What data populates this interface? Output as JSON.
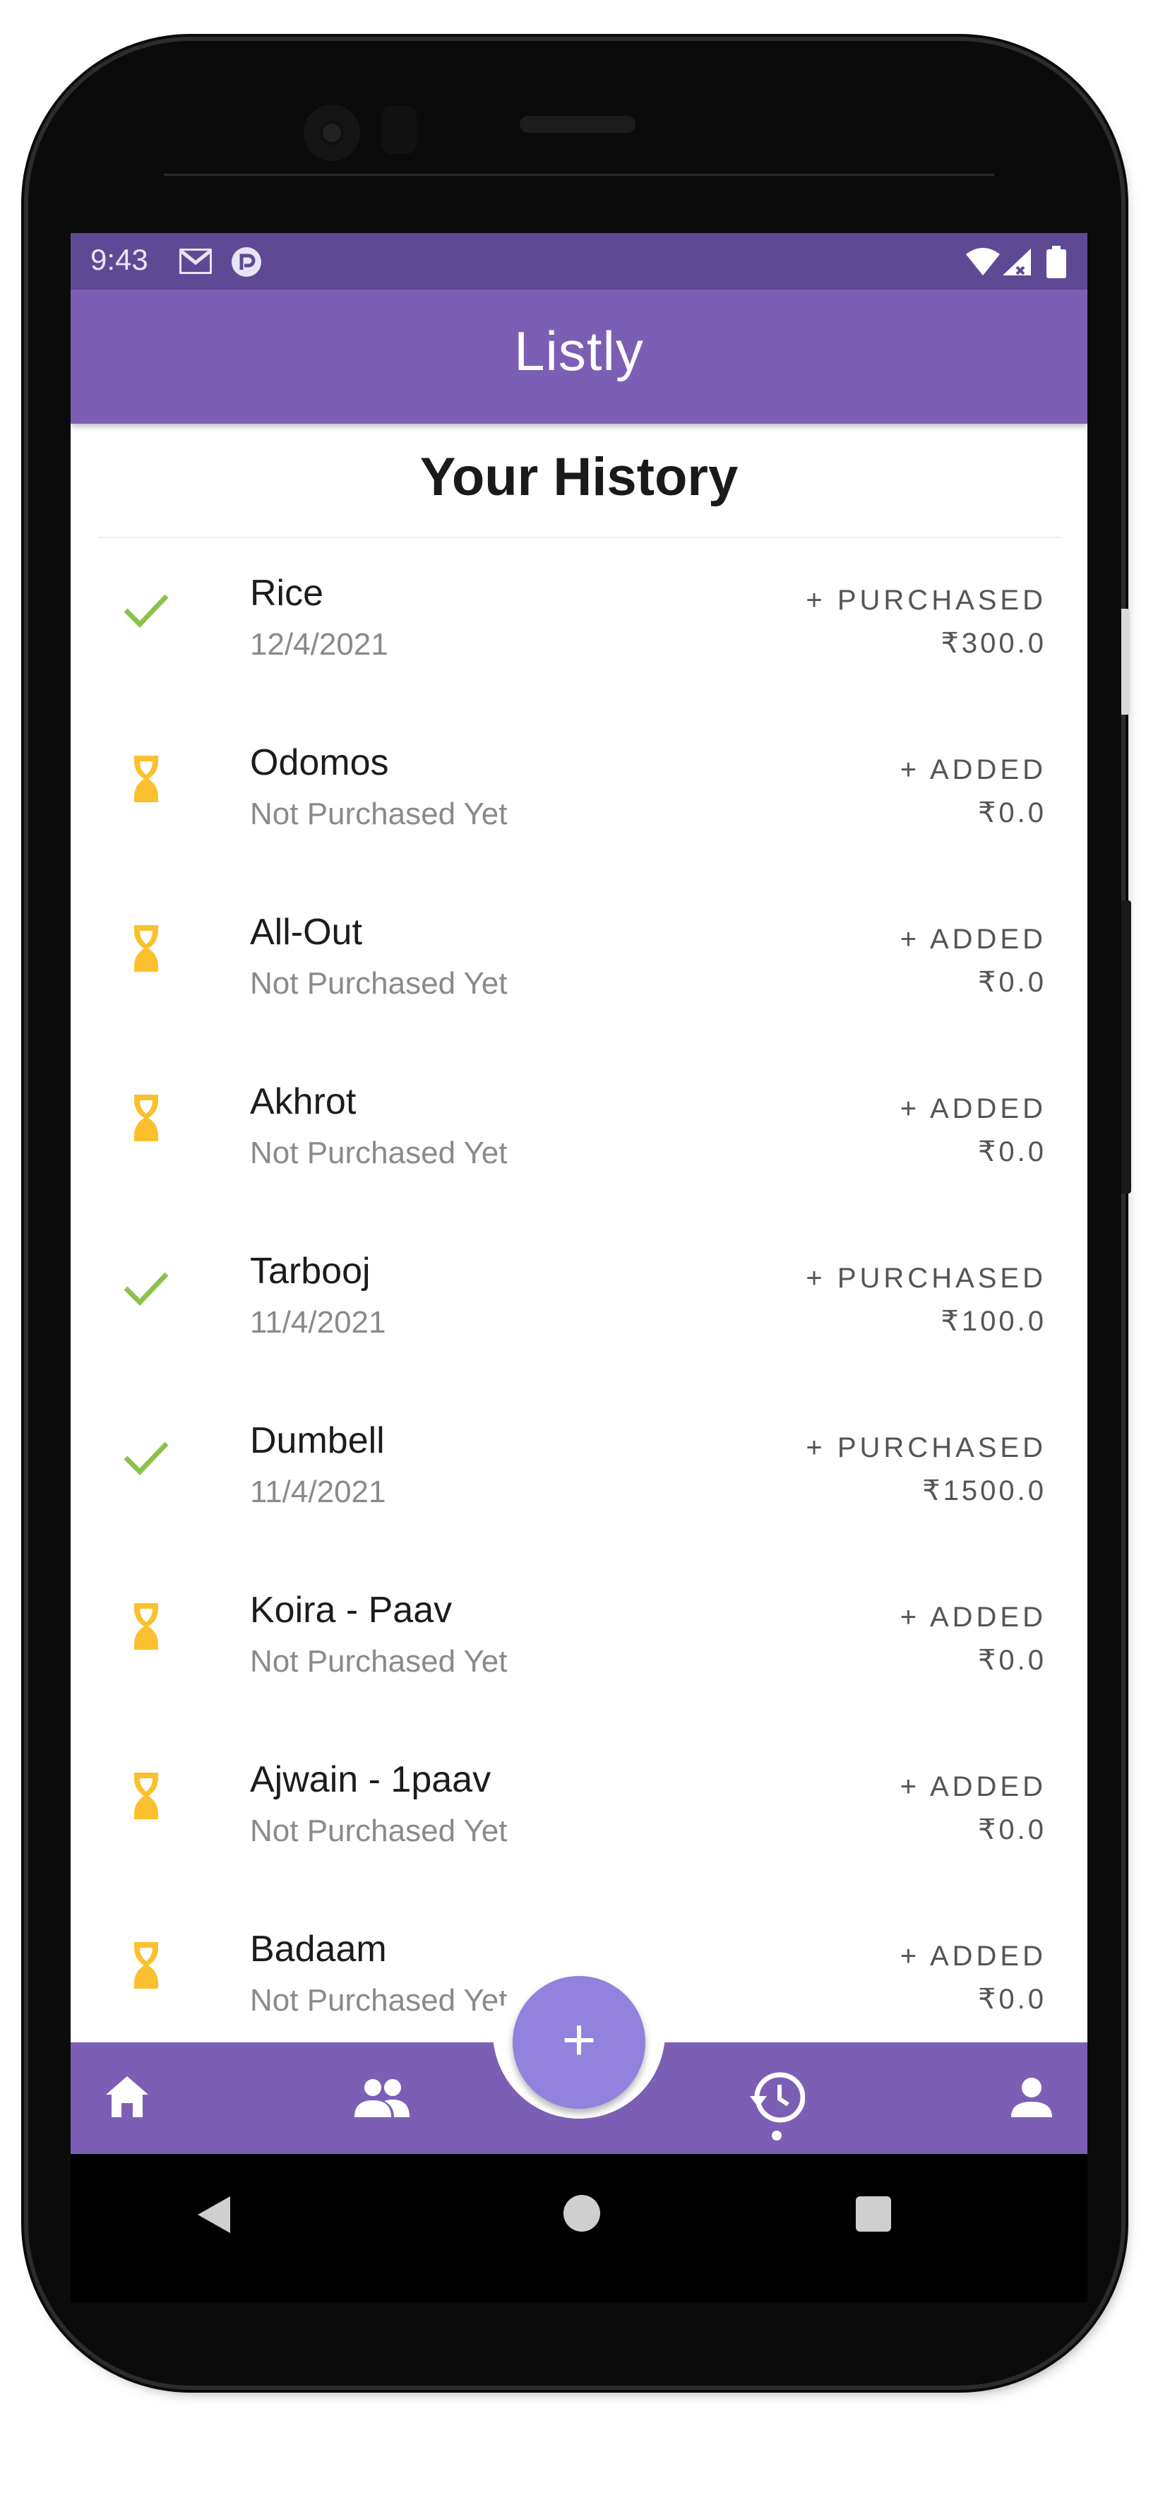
{
  "status_bar": {
    "time": "9:43"
  },
  "app_bar": {
    "title": "Listly"
  },
  "page": {
    "title": "Your History"
  },
  "history": [
    {
      "icon": "check-icon",
      "name": "Rice",
      "subtitle": "12/4/2021",
      "action": "+ PURCHASED",
      "amount": "₹300.0"
    },
    {
      "icon": "hourglass-icon",
      "name": "Odomos",
      "subtitle": "Not Purchased Yet",
      "action": "+ ADDED",
      "amount": "₹0.0"
    },
    {
      "icon": "hourglass-icon",
      "name": "All-Out",
      "subtitle": "Not Purchased Yet",
      "action": "+ ADDED",
      "amount": "₹0.0"
    },
    {
      "icon": "hourglass-icon",
      "name": "Akhrot",
      "subtitle": "Not Purchased Yet",
      "action": "+ ADDED",
      "amount": "₹0.0"
    },
    {
      "icon": "check-icon",
      "name": "Tarbooj",
      "subtitle": "11/4/2021",
      "action": "+ PURCHASED",
      "amount": "₹100.0"
    },
    {
      "icon": "check-icon",
      "name": "Dumbell",
      "subtitle": "11/4/2021",
      "action": "+ PURCHASED",
      "amount": "₹1500.0"
    },
    {
      "icon": "hourglass-icon",
      "name": "Koira - Paav",
      "subtitle": "Not Purchased Yet",
      "action": "+ ADDED",
      "amount": "₹0.0"
    },
    {
      "icon": "hourglass-icon",
      "name": "Ajwain - 1paav",
      "subtitle": "Not Purchased Yet",
      "action": "+ ADDED",
      "amount": "₹0.0"
    },
    {
      "icon": "hourglass-icon",
      "name": "Badaam",
      "subtitle": "Not Purchased Yet",
      "action": "+ ADDED",
      "amount": "₹0.0"
    }
  ],
  "fab": {
    "label": "+"
  },
  "bottom_nav": [
    {
      "icon": "home-icon"
    },
    {
      "icon": "people-icon"
    },
    {
      "icon": "history-icon"
    },
    {
      "icon": "person-icon"
    }
  ],
  "colors": {
    "primary": "#7b5fb4",
    "status_bar": "#5e4a94",
    "fab": "#9282de",
    "check": "#8bc34a",
    "hourglass": "#fbc02d"
  }
}
